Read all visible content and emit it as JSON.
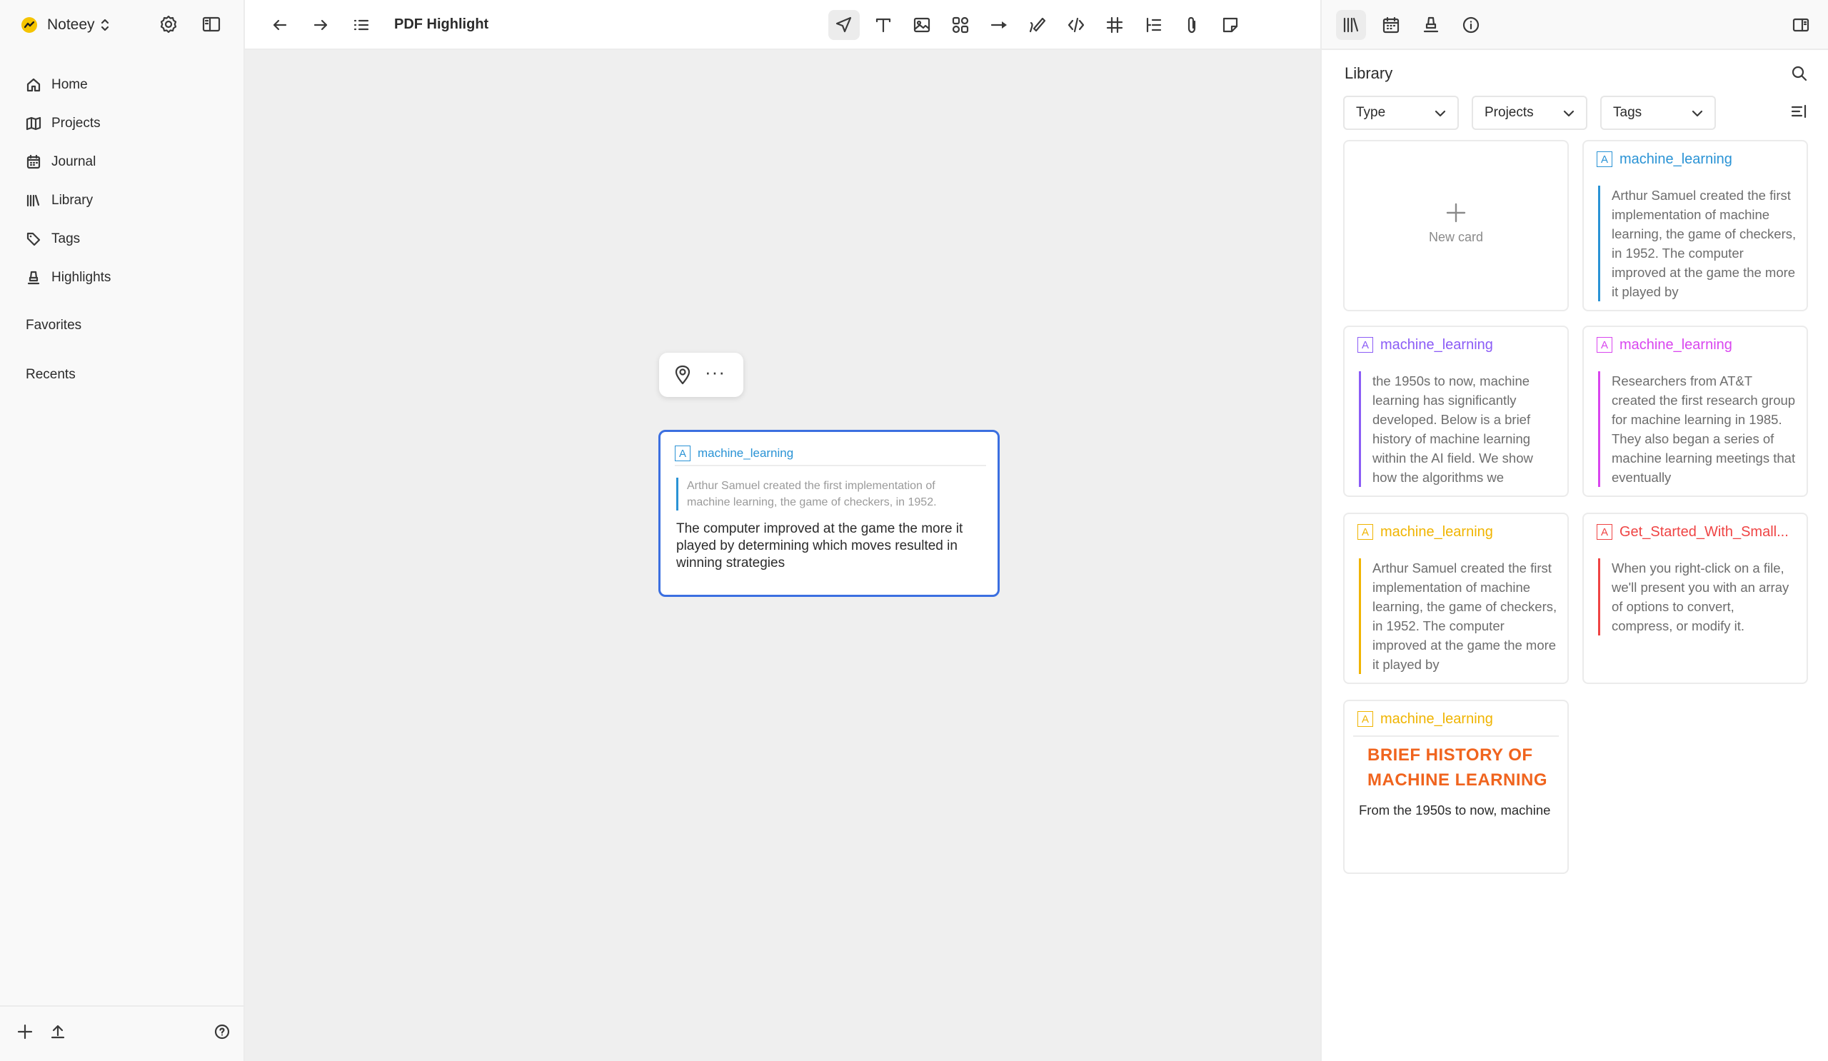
{
  "app": {
    "name": "Noteey"
  },
  "sidebar": {
    "items": [
      {
        "label": "Home"
      },
      {
        "label": "Projects"
      },
      {
        "label": "Journal"
      },
      {
        "label": "Library"
      },
      {
        "label": "Tags"
      },
      {
        "label": "Highlights"
      }
    ],
    "favorites_label": "Favorites",
    "recents_label": "Recents"
  },
  "document": {
    "title": "PDF Highlight"
  },
  "toolbar": {
    "tools": [
      "select-tool",
      "text-tool",
      "image-tool",
      "shapes-tool",
      "arrow-tool",
      "pen-tool",
      "code-tool",
      "table-tool",
      "list-tool",
      "attachment-tool",
      "sticky-note-tool"
    ],
    "active_tool": "select-tool"
  },
  "canvas_card": {
    "tag": "machine_learning",
    "tag_color": "#2a93d5",
    "quote": "Arthur Samuel created the first implementation of machine learning, the game of checkers, in 1952.",
    "note": "The computer improved at the game the more it played by determining which moves resulted in winning strategies"
  },
  "library": {
    "title": "Library",
    "filters": [
      {
        "label": "Type"
      },
      {
        "label": "Projects"
      },
      {
        "label": "Tags"
      }
    ],
    "new_card_label": "New card",
    "cards": [
      {
        "tag": "machine_learning",
        "color": "#2a93d5",
        "body": "Arthur Samuel created the first implementation of machine learning, the game of checkers, in 1952. The computer improved at the game the more it played by"
      },
      {
        "tag": "machine_learning",
        "color": "#8b5cf6",
        "body": "the 1950s to now, machine learning has significantly developed. Below is a brief history of machine learning within the AI field. We show how the algorithms we"
      },
      {
        "tag": "machine_learning",
        "color": "#d946ef",
        "body": "Researchers from AT&T created the first research group for machine learning in 1985. They also began a series of machine learning meetings that eventually"
      },
      {
        "tag": "machine_learning",
        "color": "#f0b400",
        "body": "Arthur Samuel created the first implementation of machine learning, the game of checkers, in 1952. The computer improved at the game the more it played by"
      },
      {
        "tag": "Get_Started_With_Small...",
        "color": "#ef4444",
        "body": "When you right-click on a file, we'll present you with an array of options to convert, compress, or modify it."
      },
      {
        "tag": "machine_learning",
        "color": "#f0b400",
        "heading": "BRIEF HISTORY OF MACHINE LEARNING",
        "excerpt": "From the 1950s to now, machine"
      }
    ]
  }
}
